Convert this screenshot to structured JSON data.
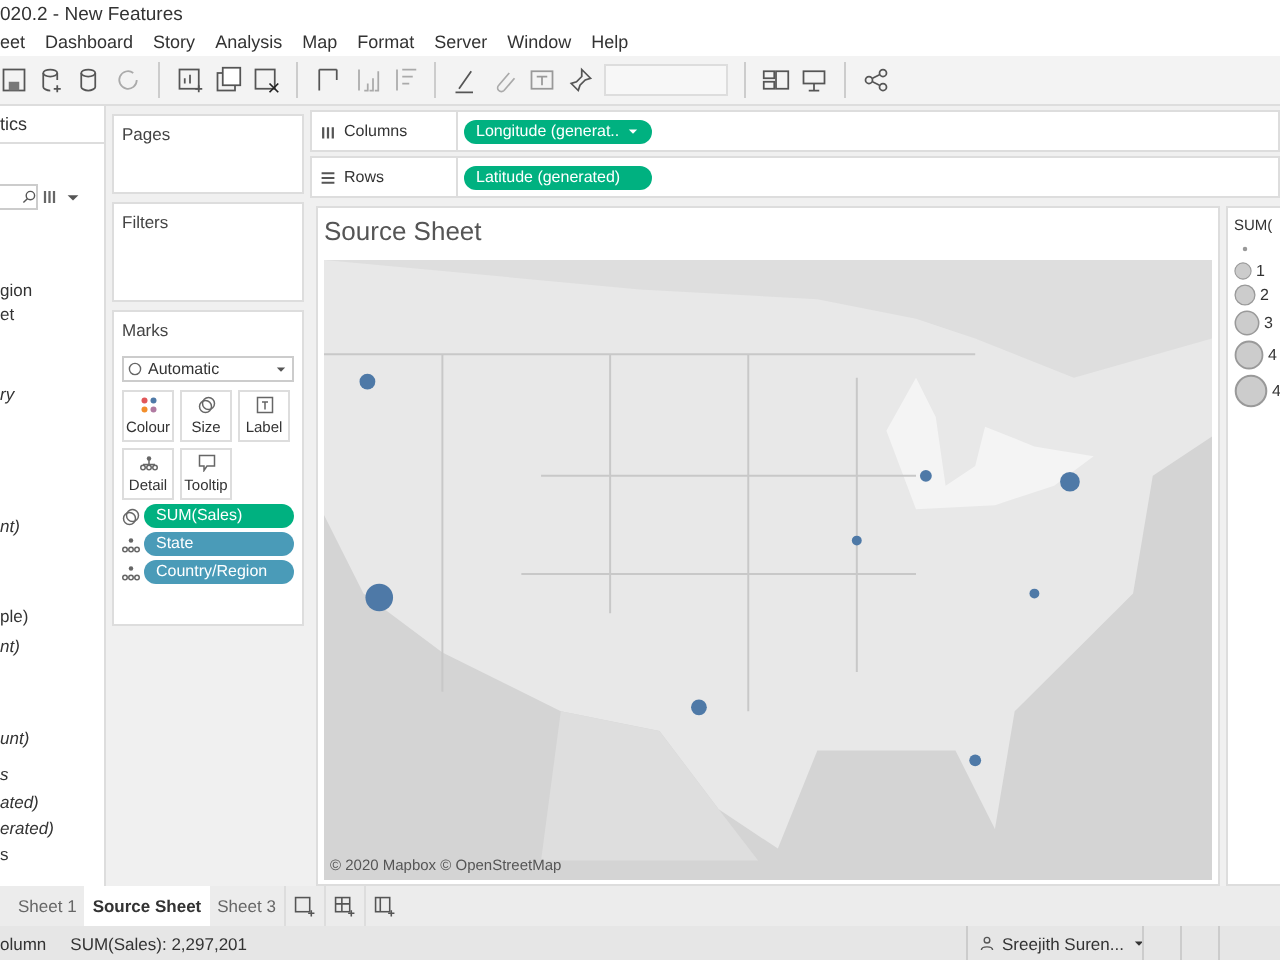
{
  "window": {
    "title": "020.2 - New Features"
  },
  "menu": [
    "eet",
    "Dashboard",
    "Story",
    "Analysis",
    "Map",
    "Format",
    "Server",
    "Window",
    "Help"
  ],
  "data_pane": {
    "title": "tics",
    "items": [
      {
        "label": "gion",
        "italic": false
      },
      {
        "label": "et",
        "italic": false
      },
      {
        "label": "ry",
        "italic": true
      },
      {
        "label": "nt)",
        "italic": true
      },
      {
        "label": "ple)",
        "italic": false
      },
      {
        "label": "nt)",
        "italic": true
      },
      {
        "label": "unt)",
        "italic": true
      },
      {
        "label": "s",
        "italic": true
      },
      {
        "label": "ated)",
        "italic": true
      },
      {
        "label": "erated)",
        "italic": true
      },
      {
        "label": "s",
        "italic": false
      }
    ]
  },
  "pages": {
    "title": "Pages"
  },
  "filters": {
    "title": "Filters"
  },
  "marks": {
    "title": "Marks",
    "mark_type": "Automatic",
    "buttons": [
      "Colour",
      "Size",
      "Label",
      "Detail",
      "Tooltip"
    ],
    "pills": [
      {
        "label": "SUM(Sales)",
        "kind": "size",
        "color": "#00b180"
      },
      {
        "label": "State",
        "kind": "detail",
        "color": "#4a9bb8"
      },
      {
        "label": "Country/Region",
        "kind": "detail",
        "color": "#4a9bb8"
      }
    ]
  },
  "shelves": [
    {
      "label": "Columns",
      "pill": "Longitude (generat..",
      "dropdown": true
    },
    {
      "label": "Rows",
      "pill": "Latitude (generated)",
      "dropdown": false
    }
  ],
  "view": {
    "title": "Source Sheet",
    "attribution": "© 2020 Mapbox © OpenStreetMap"
  },
  "legend": {
    "title": "SUM(",
    "items": [
      "1",
      "2",
      "3",
      "4",
      "4"
    ]
  },
  "tabs": [
    {
      "label": "Sheet 1",
      "selected": false
    },
    {
      "label": "Source Sheet",
      "selected": true
    },
    {
      "label": "Sheet 3",
      "selected": false
    }
  ],
  "status_bar": {
    "left": "olumn",
    "sum": "SUM(Sales): 2,297,201",
    "user": "Sreejith Suren..."
  }
}
